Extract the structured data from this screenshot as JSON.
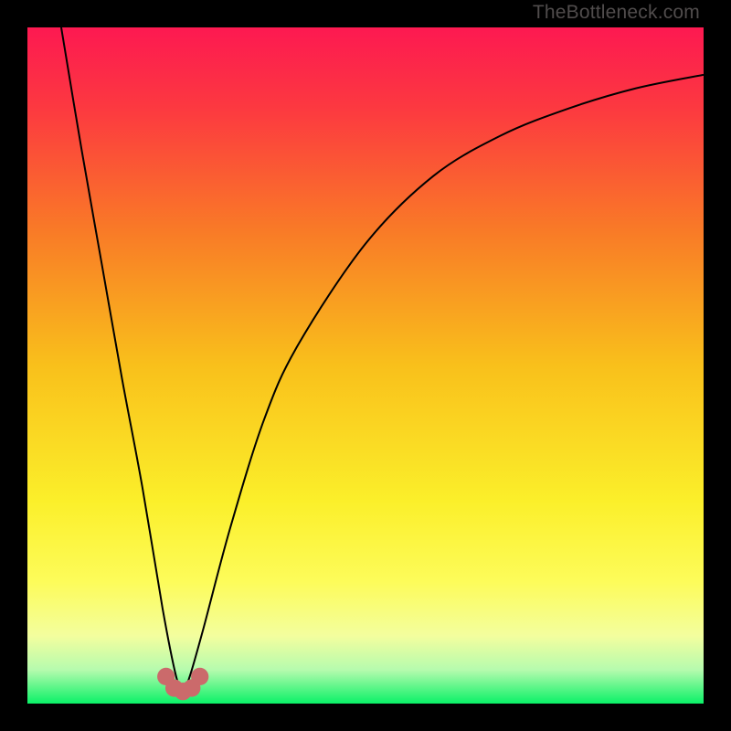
{
  "watermark": "TheBottleneck.com",
  "chart_data": {
    "type": "line",
    "title": "",
    "xlabel": "",
    "ylabel": "",
    "xlim": [
      0,
      100
    ],
    "ylim": [
      0,
      100
    ],
    "note": "Axes are unlabeled; values are percent of plot width/height estimated from the image. Lower y = better (green band). Curve bottoms out near x≈23.",
    "series": [
      {
        "name": "bottleneck-curve",
        "x": [
          5,
          8,
          11,
          14,
          17,
          20,
          22,
          23,
          24,
          26,
          30,
          35,
          40,
          50,
          60,
          70,
          80,
          90,
          100
        ],
        "y": [
          100,
          82,
          65,
          48,
          32,
          14,
          4,
          2,
          4,
          11,
          26,
          42,
          53,
          68,
          78,
          84,
          88,
          91,
          93
        ]
      }
    ],
    "bottom_markers": {
      "name": "trough-dots",
      "x": [
        20.5,
        21.7,
        23.0,
        24.3,
        25.5
      ],
      "y": [
        4.0,
        2.3,
        1.8,
        2.3,
        4.0
      ],
      "color": "#cb6a6b"
    },
    "background_gradient_stops": [
      {
        "pos": 0.0,
        "color": "#fd1951"
      },
      {
        "pos": 0.12,
        "color": "#fc3940"
      },
      {
        "pos": 0.3,
        "color": "#f97a27"
      },
      {
        "pos": 0.5,
        "color": "#f9c01b"
      },
      {
        "pos": 0.7,
        "color": "#fbef2a"
      },
      {
        "pos": 0.82,
        "color": "#fdfc5a"
      },
      {
        "pos": 0.9,
        "color": "#f3fe9e"
      },
      {
        "pos": 0.95,
        "color": "#b6fbae"
      },
      {
        "pos": 1.0,
        "color": "#0bf167"
      }
    ]
  }
}
